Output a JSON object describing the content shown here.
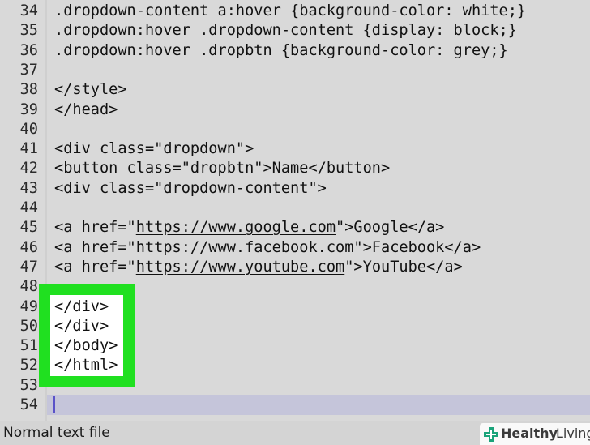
{
  "editor": {
    "lines": [
      {
        "n": "34",
        "text": ".dropdown-content a:hover {background-color: white;}"
      },
      {
        "n": "35",
        "text": ".dropdown:hover .dropdown-content {display: block;}"
      },
      {
        "n": "36",
        "text": ".dropdown:hover .dropbtn {background-color: grey;}"
      },
      {
        "n": "37",
        "text": ""
      },
      {
        "n": "38",
        "text": "</style>"
      },
      {
        "n": "39",
        "text": "</head>"
      },
      {
        "n": "40",
        "text": ""
      },
      {
        "n": "41",
        "text": "<div class=\"dropdown\">"
      },
      {
        "n": "42",
        "text": "<button class=\"dropbtn\">Name</button>"
      },
      {
        "n": "43",
        "text": "<div class=\"dropdown-content\">"
      },
      {
        "n": "44",
        "text": ""
      },
      {
        "n": "45",
        "pre": "<a href=\"",
        "url": "https://www.google.com",
        "post": "\">Google</a>"
      },
      {
        "n": "46",
        "pre": "<a href=\"",
        "url": "https://www.facebook.com",
        "post": "\">Facebook</a>"
      },
      {
        "n": "47",
        "pre": "<a href=\"",
        "url": "https://www.youtube.com",
        "post": "\">YouTube</a>"
      },
      {
        "n": "48",
        "text": ""
      },
      {
        "n": "49",
        "text": "</div>"
      },
      {
        "n": "50",
        "text": "</div>"
      },
      {
        "n": "51",
        "text": "</body>"
      },
      {
        "n": "52",
        "text": "</html>"
      },
      {
        "n": "53",
        "text": ""
      },
      {
        "n": "54",
        "text": ""
      }
    ]
  },
  "status_bar": {
    "file_type": "Normal text file"
  },
  "watermark": {
    "brand_bold": "Healthy",
    "brand_light": "Living"
  },
  "colors": {
    "highlight": "#20e020",
    "current_line": "#c5c5da",
    "background": "#d9d9d9"
  }
}
